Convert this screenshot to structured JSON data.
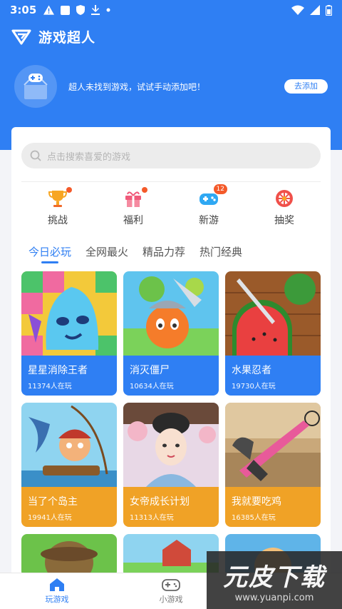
{
  "status": {
    "time": "3:05"
  },
  "app": {
    "title": "游戏超人"
  },
  "notice": {
    "text": "超人未找到游戏，试试手动添加吧！",
    "add_label": "去添加"
  },
  "search": {
    "placeholder": "点击搜索喜爱的游戏"
  },
  "categories": [
    {
      "label": "挑战",
      "icon": "trophy-icon",
      "dot": true
    },
    {
      "label": "福利",
      "icon": "gift-icon",
      "dot": true
    },
    {
      "label": "新游",
      "icon": "gamepad-icon",
      "badge": "12"
    },
    {
      "label": "抽奖",
      "icon": "lottery-wheel-icon"
    }
  ],
  "tabs": [
    "今日必玩",
    "全网最火",
    "精品力荐",
    "热门经典"
  ],
  "games": [
    {
      "name": "星星消除王者",
      "players": "11374人在玩",
      "color": "#2f7ff3"
    },
    {
      "name": "消灭僵尸",
      "players": "10634人在玩",
      "color": "#2f7ff3"
    },
    {
      "name": "水果忍者",
      "players": "19730人在玩",
      "color": "#2f7ff3"
    },
    {
      "name": "当了个岛主",
      "players": "19941人在玩",
      "color": "#f0a226"
    },
    {
      "name": "女帝成长计划",
      "players": "11313人在玩",
      "color": "#f0a226"
    },
    {
      "name": "我就要吃鸡",
      "players": "16385人在玩",
      "color": "#f0a226"
    }
  ],
  "bottom_nav": {
    "play": "玩游戏",
    "mini": "小游戏"
  },
  "watermark": {
    "brand": "元皮下载",
    "url": "www.yuanpi.com"
  },
  "colors": {
    "accent": "#2f7ff3",
    "badge": "#f45a2a",
    "orange": "#f0a226"
  }
}
